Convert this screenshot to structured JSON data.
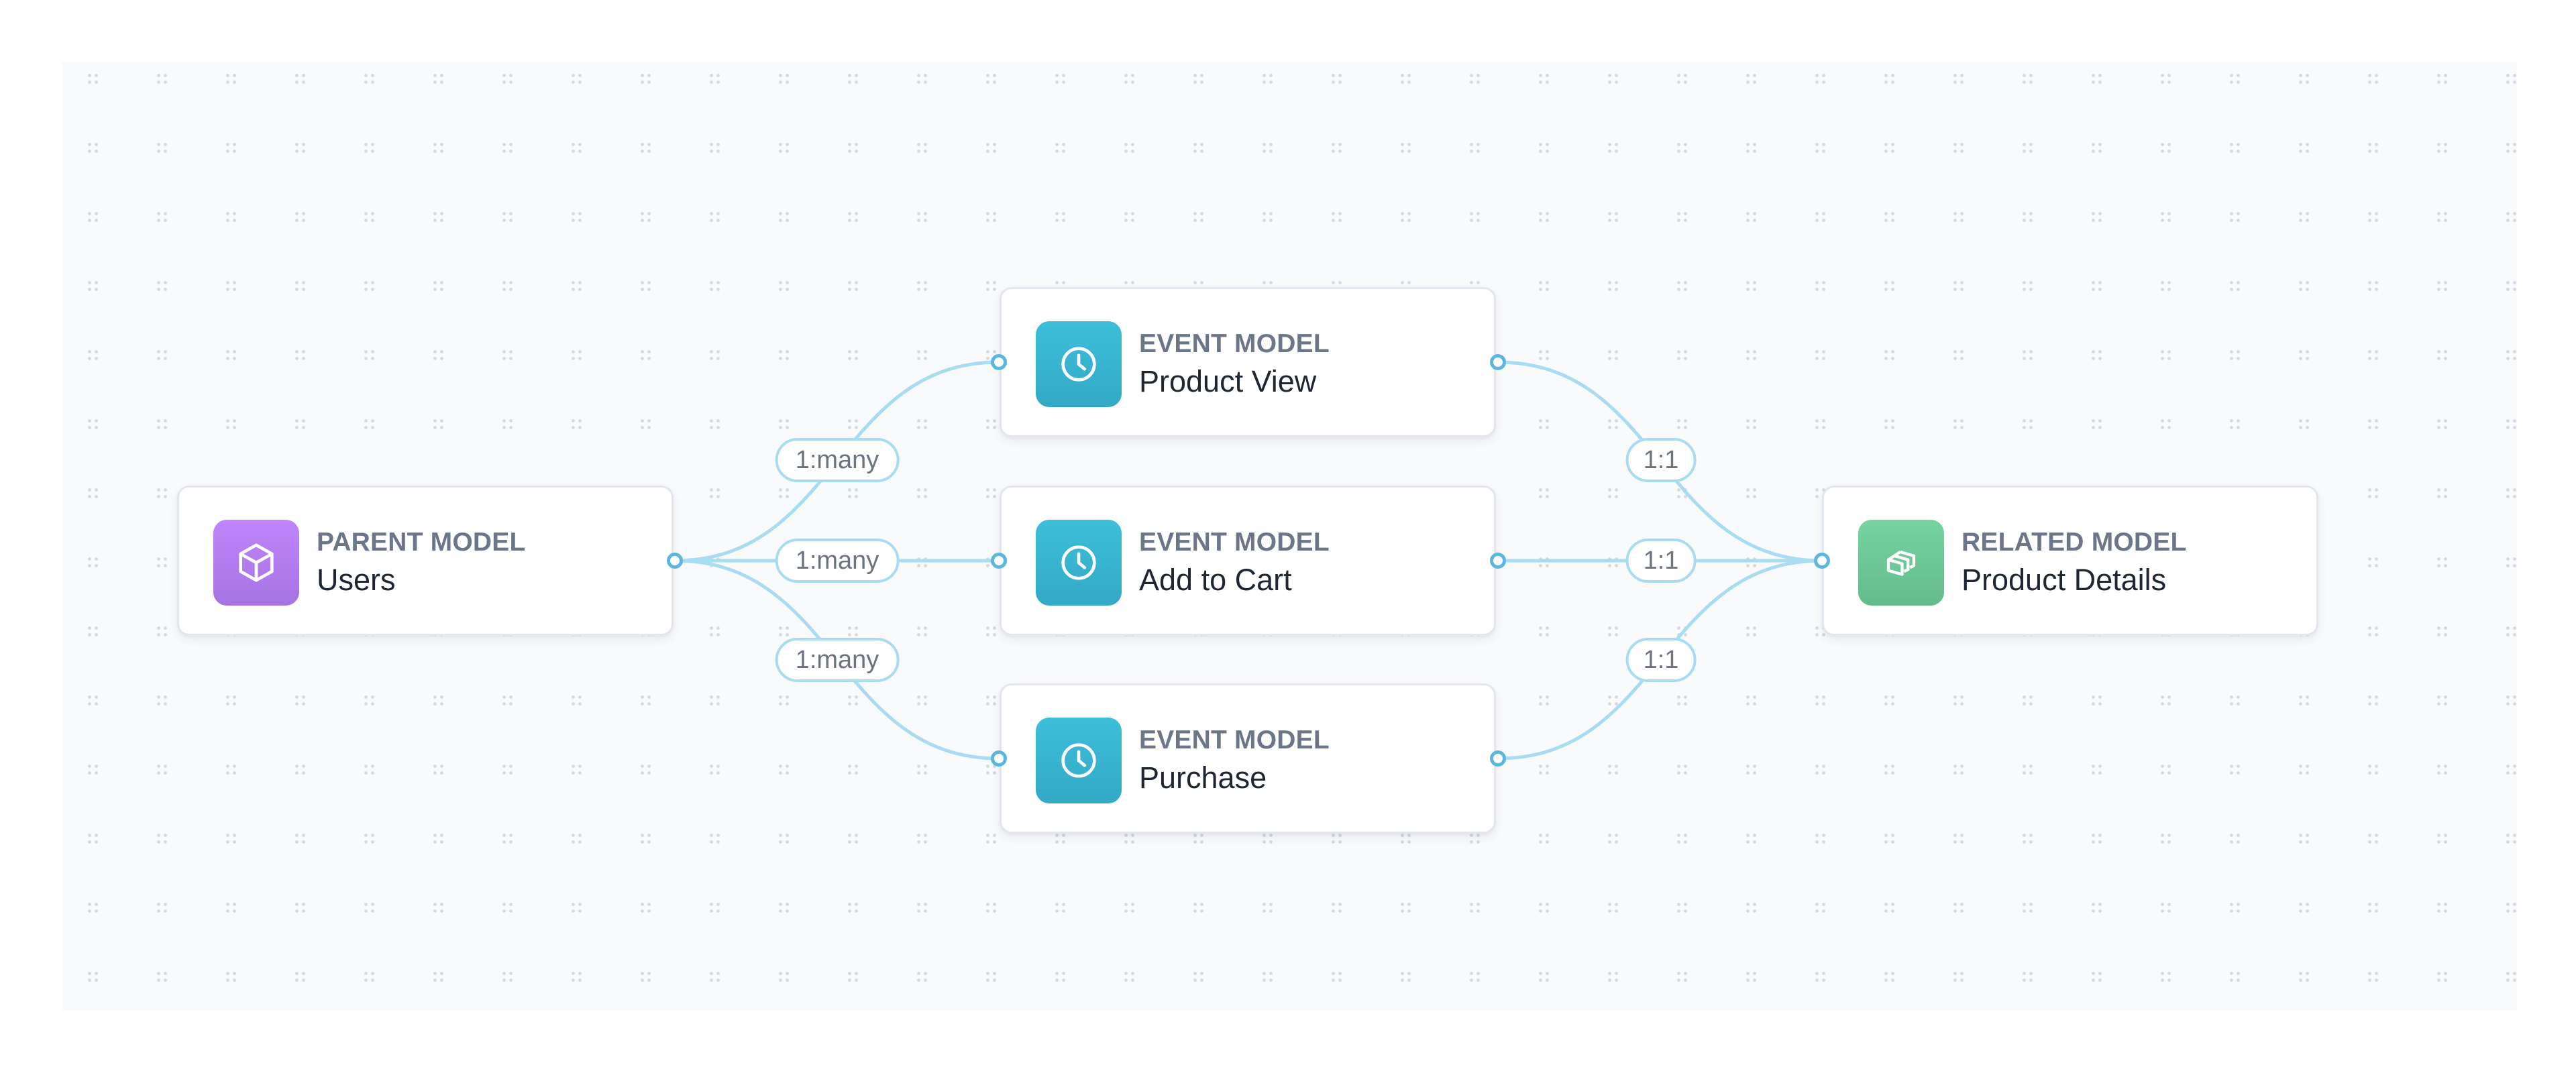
{
  "diagram": {
    "nodes": [
      {
        "id": "users",
        "kind": "PARENT MODEL",
        "title": "Users",
        "icon": "cube-icon",
        "color": "#b07ff0"
      },
      {
        "id": "product_view",
        "kind": "EVENT MODEL",
        "title": "Product View",
        "icon": "clock-icon",
        "color": "#37b4d0"
      },
      {
        "id": "add_to_cart",
        "kind": "EVENT MODEL",
        "title": "Add to Cart",
        "icon": "clock-icon",
        "color": "#37b4d0"
      },
      {
        "id": "purchase",
        "kind": "EVENT MODEL",
        "title": "Purchase",
        "icon": "clock-icon",
        "color": "#37b4d0"
      },
      {
        "id": "product_details",
        "kind": "RELATED MODEL",
        "title": "Product Details",
        "icon": "stacked-cards-icon",
        "color": "#6cc797"
      }
    ],
    "edges": [
      {
        "from": "users",
        "to": "product_view",
        "label": "1:many"
      },
      {
        "from": "users",
        "to": "add_to_cart",
        "label": "1:many"
      },
      {
        "from": "users",
        "to": "purchase",
        "label": "1:many"
      },
      {
        "from": "product_view",
        "to": "product_details",
        "label": "1:1"
      },
      {
        "from": "add_to_cart",
        "to": "product_details",
        "label": "1:1"
      },
      {
        "from": "purchase",
        "to": "product_details",
        "label": "1:1"
      }
    ],
    "edge_color": "#a9dcf2",
    "handle_color": "#5ab8e0"
  }
}
